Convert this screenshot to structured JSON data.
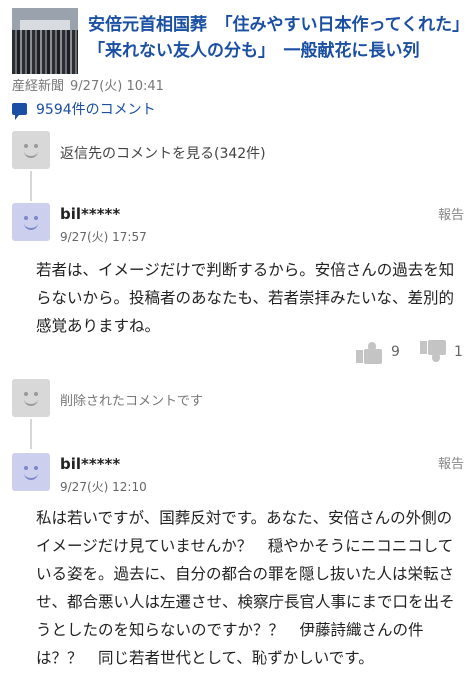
{
  "article": {
    "title": "安倍元首相国葬　「住みやすい日本作ってくれた」「来れない友人の分も」　一般献花に長い列",
    "source": "産経新聞",
    "date": "9/27(火) 10:41"
  },
  "comment_count": "9594件のコメント",
  "thread1": {
    "parent_link": "返信先のコメントを見る(342件)",
    "reply": {
      "user": "bil*****",
      "time": "9/27(火) 17:57",
      "report": "報告",
      "body": "若者は、イメージだけで判断するから。安倍さんの過去を知らないから。投稿者のあなたも、若者崇拝みたいな、差別的感覚ありますね。",
      "likes": "9",
      "dislikes": "1"
    }
  },
  "thread2": {
    "parent_deleted": "削除されたコメントです",
    "reply": {
      "user": "bil*****",
      "time": "9/27(火) 12:10",
      "report": "報告",
      "body": "私は若いですが、国葬反対です。あなた、安倍さんの外側のイメージだけ見ていませんか？　穏やかそうにニコニコしている姿を。過去に、自分の都合の罪を隠し抜いた人は栄転させ、都合悪い人は左遷させ、検察庁長官人事にまで口を出そうとしたのを知らないのですか？？　伊藤詩織さんの件は？？　同じ若者世代として、恥ずかしいです。"
    }
  }
}
